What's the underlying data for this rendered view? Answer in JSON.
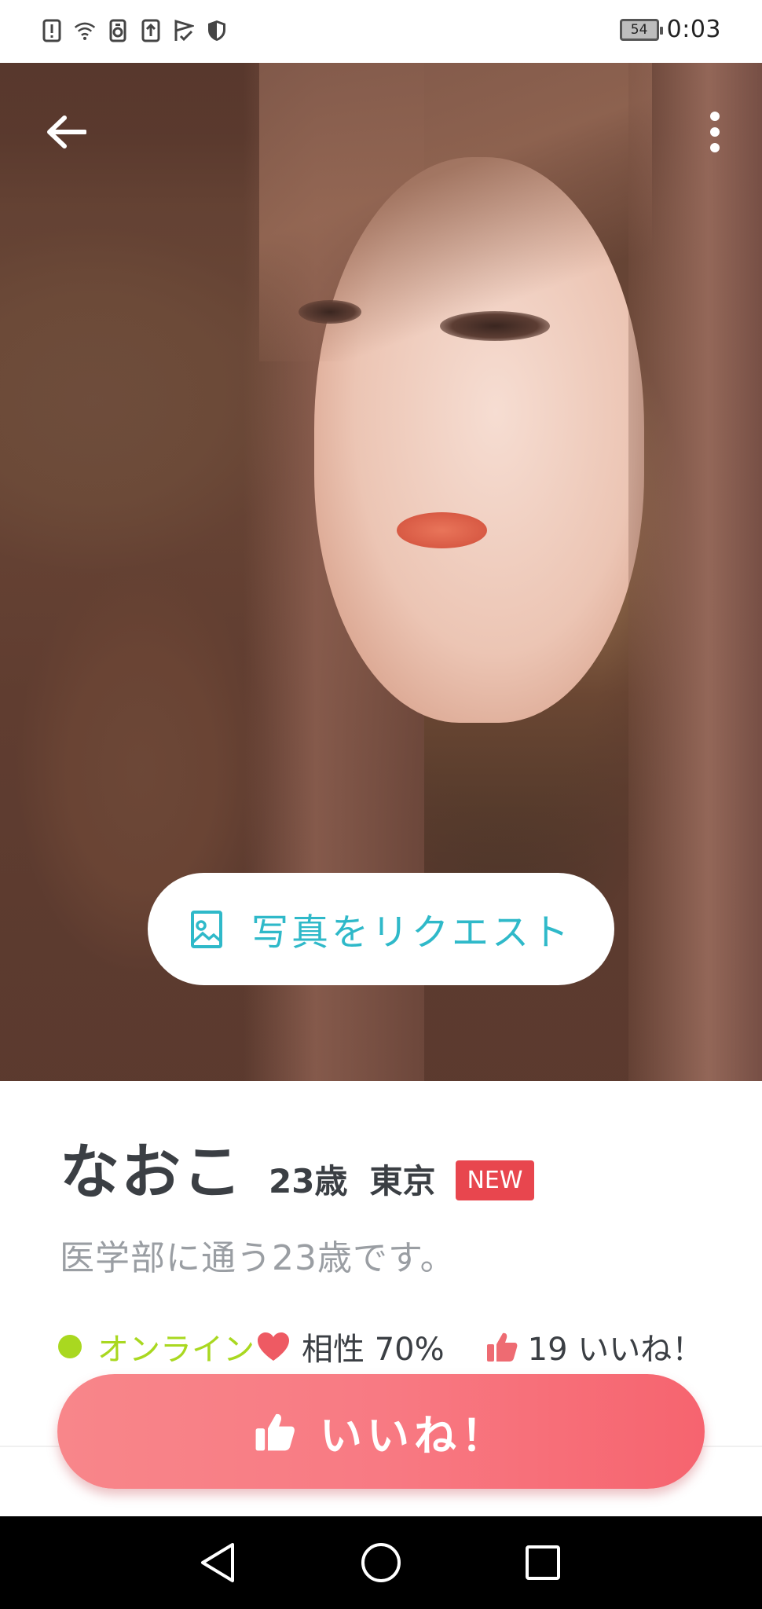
{
  "status_bar": {
    "battery": "54",
    "time": "0:03",
    "icons": [
      "alert-icon",
      "wifi-icon",
      "sim-icon",
      "upload-icon",
      "check-flag-icon",
      "shield-icon"
    ]
  },
  "header": {
    "back_icon": "arrow-left-icon",
    "more_icon": "more-vertical-icon"
  },
  "photo": {
    "request_label": "写真をリクエスト",
    "request_icon": "image-icon"
  },
  "profile": {
    "name": "なおこ",
    "age": "23歳",
    "location": "東京",
    "badge": "NEW",
    "intro": "医学部に通う23歳です。"
  },
  "stats": {
    "online": "オンライン",
    "compatibility": "相性 70%",
    "likes": "19 いいね！"
  },
  "action": {
    "like_label": "いいね！",
    "like_icon": "thumbs-up-icon"
  },
  "colors": {
    "accent_teal": "#2fb9c9",
    "online_green": "#a9d820",
    "new_badge": "#e8464e",
    "like_button": "#f87a83"
  }
}
